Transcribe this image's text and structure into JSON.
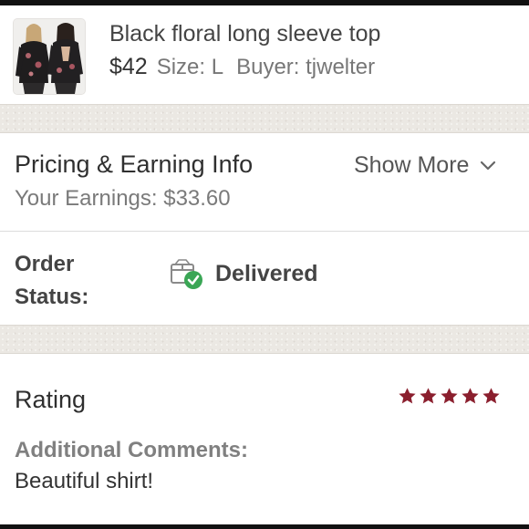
{
  "item": {
    "title": "Black floral long sleeve top",
    "price": "$42",
    "size": "Size: L",
    "buyer": "Buyer: tjwelter",
    "thumbnail_icon": "product-photo"
  },
  "pricing": {
    "title": "Pricing & Earning Info",
    "show_more": "Show More",
    "earnings": "Your Earnings: $33.60"
  },
  "order_status": {
    "label": "Order Status:",
    "value": "Delivered",
    "icon": "delivered-box-check-icon",
    "check_color": "#3aa655"
  },
  "rating": {
    "title": "Rating",
    "stars": 5,
    "max_stars": 5,
    "star_color": "#8b1f2e",
    "comments_label": "Additional Comments:",
    "comments": "Beautiful shirt!"
  }
}
